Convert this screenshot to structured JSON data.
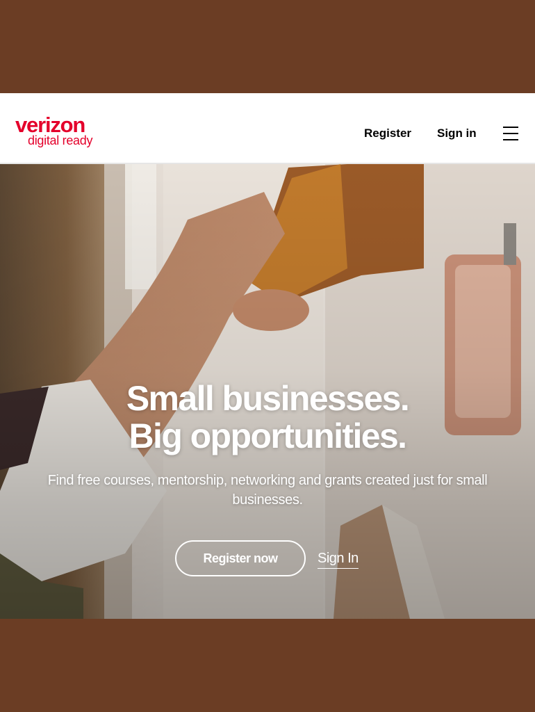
{
  "header": {
    "logo_brand": "verizon",
    "logo_sub": "digital ready",
    "nav_register": "Register",
    "nav_signin": "Sign in",
    "menu_icon": "hamburger-menu-icon"
  },
  "hero": {
    "headline_line1": "Small businesses.",
    "headline_line2": "Big opportunities.",
    "subtext": "Find free courses, mentorship, networking and grants created just for small businesses.",
    "cta_register": "Register now",
    "cta_signin": "Sign In"
  },
  "colors": {
    "brand_red": "#e4002b",
    "frame_brown": "#6b3d24",
    "text_white": "#ffffff"
  }
}
